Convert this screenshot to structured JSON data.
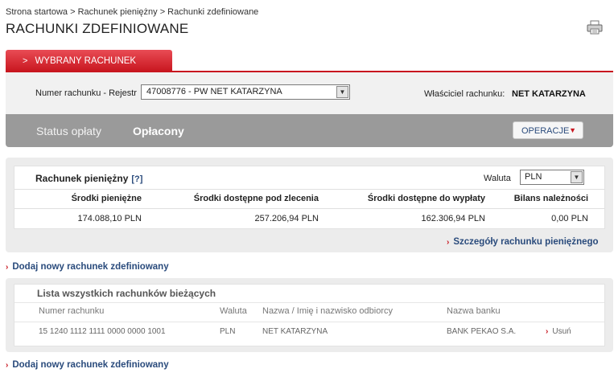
{
  "breadcrumb": "Strona startowa > Rachunek pieniężny > Rachunki zdefiniowane",
  "page_title": "RACHUNKI ZDEFINIOWANE",
  "tab": {
    "label": "WYBRANY RACHUNEK"
  },
  "account": {
    "label": "Numer rachunku - Rejestr",
    "selected": "47008776 - PW NET KATARZYNA",
    "owner_label": "Właściciel rachunku:",
    "owner_value": "NET KATARZYNA"
  },
  "status": {
    "label": "Status opłaty",
    "value": "Opłacony",
    "operations_button": "OPERACJE"
  },
  "cash_account": {
    "title": "Rachunek pieniężny",
    "help": "[?]",
    "currency_label": "Waluta",
    "currency_selected": "PLN",
    "columns": [
      "Środki pieniężne",
      "Środki dostępne pod zlecenia",
      "Środki dostępne do wypłaty",
      "Bilans należności"
    ],
    "values": [
      "174.088,10  PLN",
      "257.206,94  PLN",
      "162.306,94  PLN",
      "0,00  PLN"
    ]
  },
  "details_link": "Szczegóły rachunku pieniężnego",
  "add_account_link": "Dodaj nowy rachunek zdefiniowany",
  "accounts_list": {
    "title": "Lista wszystkich rachunków bieżących",
    "columns": [
      "Numer rachunku",
      "Waluta",
      "Nazwa / Imię i nazwisko odbiorcy",
      "Nazwa banku"
    ],
    "rows": [
      {
        "number": "15 1240 1112 1111 0000 0000 1001",
        "currency": "PLN",
        "recipient": "NET KATARZYNA",
        "bank": "BANK PEKAO S.A.",
        "action": "Usuń"
      }
    ]
  },
  "colors": {
    "accent_red": "#c8161f",
    "link_blue": "#2a4b7c",
    "status_bar": "#9a9a9a"
  },
  "icons": {
    "print": "printer-icon",
    "chevron": "chevron-right-icon",
    "dropdown": "chevron-down-icon"
  }
}
